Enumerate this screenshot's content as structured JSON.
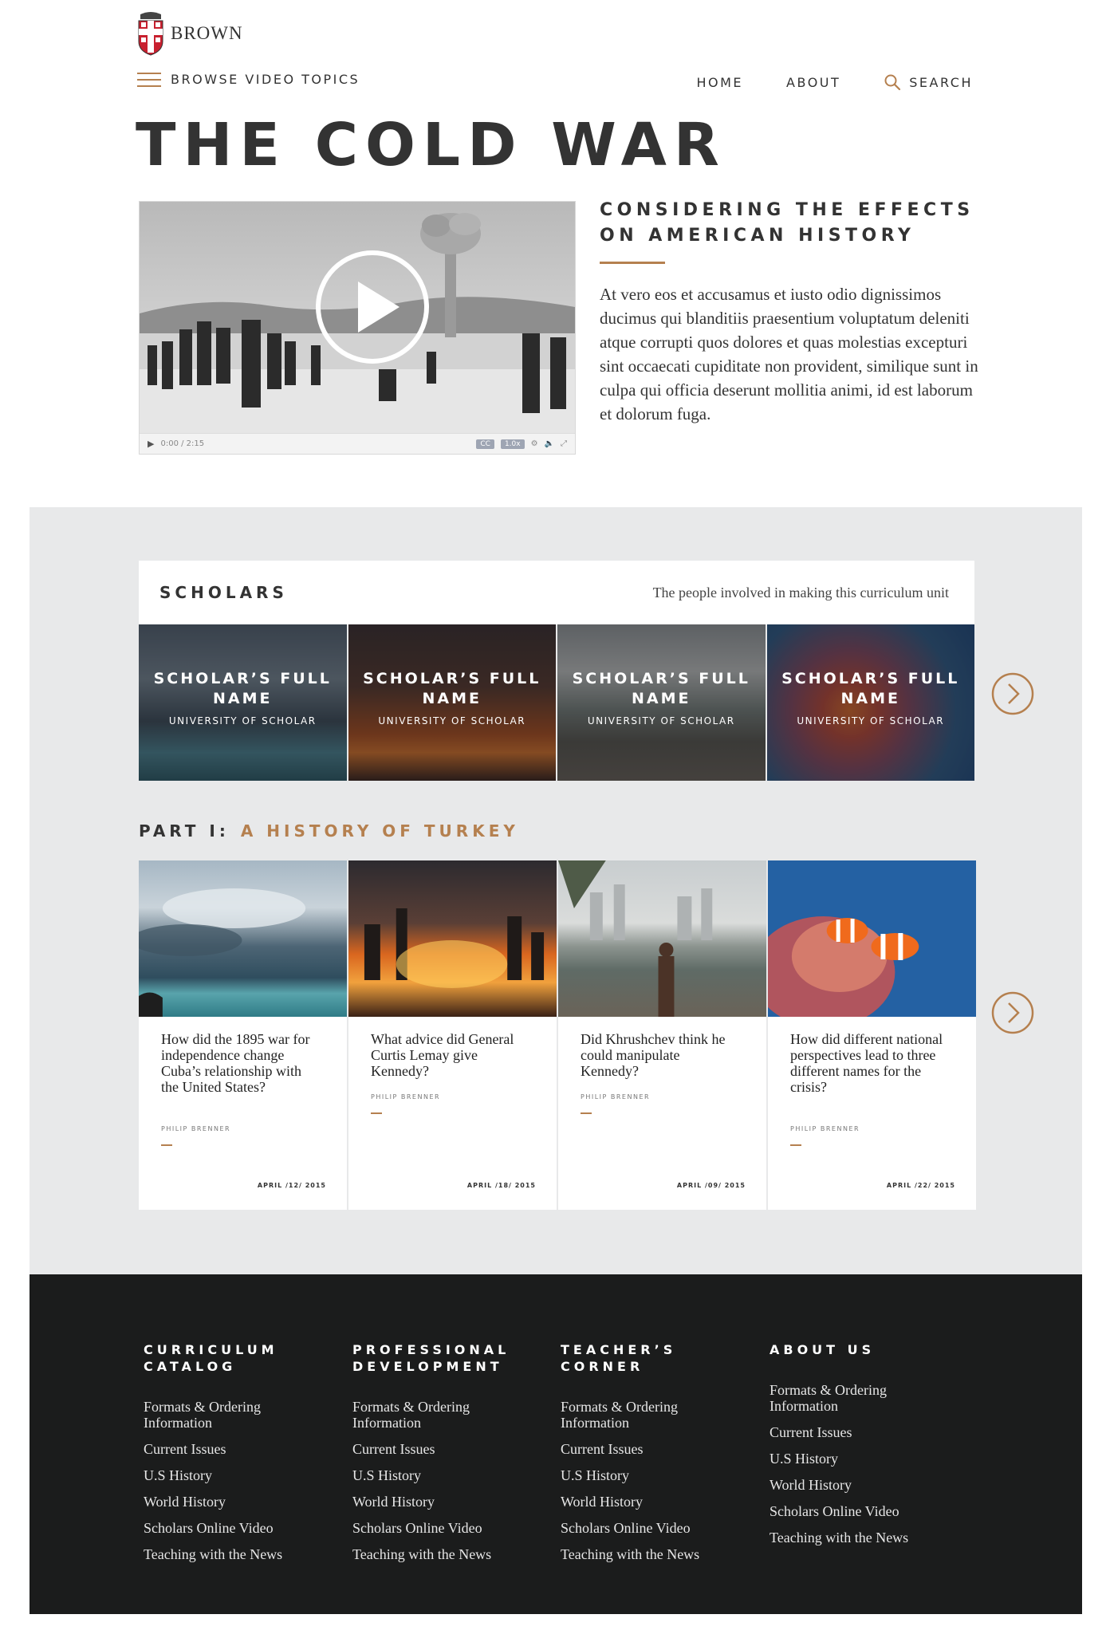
{
  "brand": {
    "name": "BROWN"
  },
  "nav": {
    "browse_label": "BROWSE VIDEO TOPICS",
    "home": "HOME",
    "about": "ABOUT",
    "search": "SEARCH"
  },
  "page_title": "THE COLD WAR",
  "video": {
    "time": "0:00 / 2:15",
    "cc": "CC",
    "speed": "1.0x"
  },
  "intro": {
    "subtitle": "CONSIDERING THE EFFECTS ON AMERICAN HISTORY",
    "body": "At vero eos et accusamus et iusto odio dignissimos ducimus qui blanditiis praesentium voluptatum deleniti atque corrupti quos dolores et quas molestias excepturi sint occaecati cupiditate non provident, similique sunt in culpa qui officia deserunt mollitia animi, id est laborum et dolorum fuga."
  },
  "scholars": {
    "title": "SCHOLARS",
    "note": "The people involved in making this curriculum unit",
    "items": [
      {
        "name": "SCHOLAR’S FULL NAME",
        "university": "UNIVERSITY OF SCHOLAR"
      },
      {
        "name": "SCHOLAR’S FULL NAME",
        "university": "UNIVERSITY OF SCHOLAR"
      },
      {
        "name": "SCHOLAR’S FULL NAME",
        "university": "UNIVERSITY OF SCHOLAR"
      },
      {
        "name": "SCHOLAR’S FULL NAME",
        "university": "UNIVERSITY OF SCHOLAR"
      }
    ]
  },
  "part": {
    "label": "PART I:",
    "title": "A HISTORY OF TURKEY"
  },
  "cards": [
    {
      "question": "How did the 1895 war for independence change Cuba’s relationship with the United States?",
      "author": "PHILIP BRENNER",
      "date": "APRIL /12/ 2015"
    },
    {
      "question": "What advice did General Curtis Lemay give Kennedy?",
      "author": "PHILIP BRENNER",
      "date": "APRIL /18/ 2015"
    },
    {
      "question": "Did Khrushchev think he could manipulate Kennedy?",
      "author": "PHILIP BRENNER",
      "date": "APRIL /09/ 2015"
    },
    {
      "question": "How did different national perspectives lead to three different names for the crisis?",
      "author": "PHILIP BRENNER",
      "date": "APRIL /22/ 2015"
    }
  ],
  "footer": {
    "columns": [
      {
        "heading": "CURRICULUM CATALOG",
        "links": [
          "Formats & Ordering Information",
          "Current Issues",
          "U.S History",
          "World History",
          "Scholars Online Video",
          "Teaching with the News"
        ]
      },
      {
        "heading": "PROFESSIONAL DEVELOPMENT",
        "links": [
          "Formats & Ordering Information",
          "Current Issues",
          "U.S History",
          "World History",
          "Scholars Online Video",
          "Teaching with the News"
        ]
      },
      {
        "heading": "TEACHER’S CORNER",
        "links": [
          "Formats & Ordering Information",
          "Current Issues",
          "U.S History",
          "World History",
          "Scholars Online Video",
          "Teaching with the News"
        ]
      },
      {
        "heading": "ABOUT US",
        "links": [
          "Formats & Ordering Information",
          "Current Issues",
          "U.S History",
          "World History",
          "Scholars Online Video",
          "Teaching with the News"
        ]
      }
    ]
  },
  "colors": {
    "accent": "#b5804f",
    "text": "#333333",
    "section_bg": "#e8e9ea",
    "footer_bg": "#1b1c1c",
    "brown_red": "#c8202f"
  },
  "icons": [
    "brown-shield-icon",
    "hamburger-icon",
    "search-icon",
    "play-icon",
    "chevron-right-icon",
    "volume-icon",
    "settings-icon",
    "fullscreen-icon"
  ]
}
